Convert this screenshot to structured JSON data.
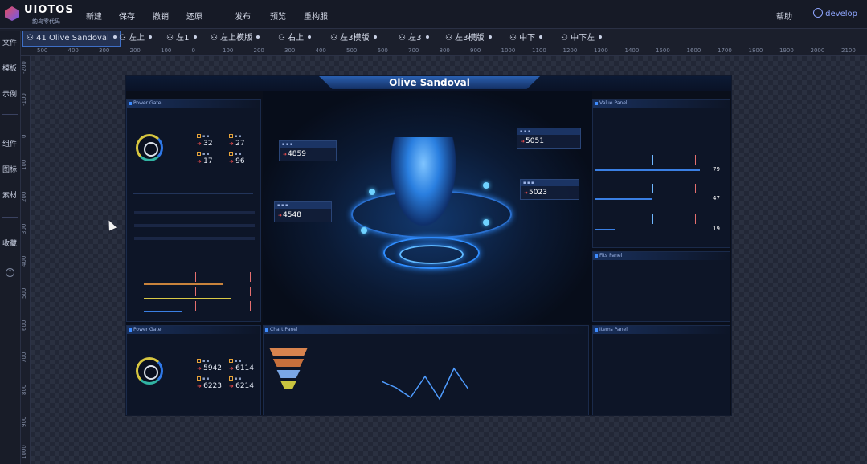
{
  "app": {
    "logo_text": "UIOTOS",
    "logo_sub": "韵鸟零代码"
  },
  "menu": {
    "new": "新建",
    "save": "保存",
    "undo": "撤销",
    "redo": "还原",
    "publish": "发布",
    "preview": "预览",
    "my": "重构服"
  },
  "header_right": {
    "help": "帮助",
    "user": "develop"
  },
  "tabs": [
    {
      "label": "41 Olive Sandoval"
    },
    {
      "label": "左上"
    },
    {
      "label": "左1"
    },
    {
      "label": "左上模版"
    },
    {
      "label": "右上"
    },
    {
      "label": "左3模版"
    },
    {
      "label": "左3"
    },
    {
      "label": "左3模版"
    },
    {
      "label": "中下"
    },
    {
      "label": "中下左"
    }
  ],
  "sidebar": [
    "文件",
    "模板",
    "示例",
    "组件",
    "图标",
    "素材",
    "收藏"
  ],
  "ruler_h": [
    "500",
    "400",
    "300",
    "200",
    "100",
    "0",
    "100",
    "200",
    "300",
    "400",
    "500",
    "600",
    "700",
    "800",
    "900",
    "1000",
    "1100",
    "1200",
    "1300",
    "1400",
    "1500",
    "1600",
    "1700",
    "1800",
    "1900",
    "2000",
    "2100"
  ],
  "ruler_v": [
    "-200",
    "-100",
    "0",
    "100",
    "200",
    "300",
    "400",
    "500",
    "600",
    "700",
    "800",
    "900",
    "1000"
  ],
  "screen": {
    "title": "Olive Sandoval",
    "center_values": {
      "top_left": "4859",
      "mid_left": "4548",
      "top_right": "5051",
      "mid_right": "5023"
    },
    "panel1": {
      "title": "Power Gate",
      "stats": [
        "32",
        "27",
        "17",
        "96"
      ]
    },
    "panel2": {
      "title": "Power Gate",
      "stats": [
        "5942",
        "6114",
        "6223",
        "6214"
      ]
    },
    "panel_titles": {
      "right_top": "Value Panel",
      "right_mid": "Fits Panel",
      "right_bottom": "Items Panel",
      "center_bottom": "Chart Panel"
    },
    "right_values": [
      "79",
      "47",
      "19"
    ]
  }
}
